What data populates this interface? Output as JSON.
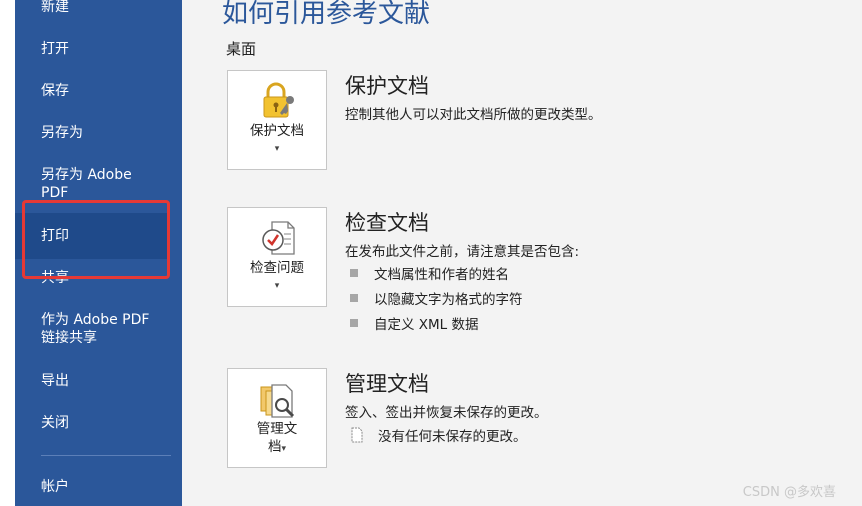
{
  "nav": {
    "items": [
      {
        "label": "新建"
      },
      {
        "label": "打开"
      },
      {
        "label": "保存"
      },
      {
        "label": "另存为"
      },
      {
        "label": "另存为 Adobe PDF"
      },
      {
        "label": "打印"
      },
      {
        "label": "共享"
      },
      {
        "label": "作为 Adobe PDF 链接共享"
      },
      {
        "label": "导出"
      },
      {
        "label": "关闭"
      },
      {
        "label": "帐户"
      }
    ]
  },
  "main": {
    "title": "如何引用参考文献",
    "location": "桌面",
    "sections": [
      {
        "button_label": "保护文档",
        "title": "保护文档",
        "description": "控制其他人可以对此文档所做的更改类型。",
        "icon": "lock-key-icon"
      },
      {
        "button_label": "检查问题",
        "title": "检查文档",
        "description": "在发布此文件之前，请注意其是否包含:",
        "bullets": [
          "文档属性和作者的姓名",
          "以隐藏文字为格式的字符",
          "自定义 XML 数据"
        ],
        "icon": "inspect-document-icon"
      },
      {
        "button_label_line1": "管理文",
        "button_label_line2": "档",
        "title": "管理文档",
        "description": "签入、签出并恢复未保存的更改。",
        "note": "没有任何未保存的更改。",
        "icon": "manage-document-icon"
      }
    ]
  },
  "watermark": "CSDN @多欢喜",
  "colors": {
    "sidebar": "#2b579a",
    "highlight_border": "#e53935",
    "title": "#2b579a"
  }
}
